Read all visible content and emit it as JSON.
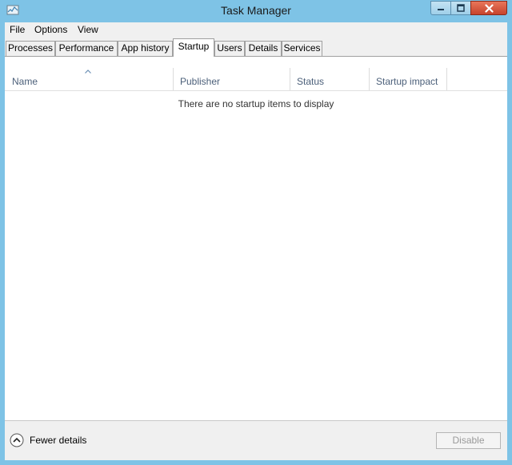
{
  "window": {
    "title": "Task Manager",
    "accent_color": "#7ec3e6",
    "close_color": "#c7432c",
    "icon": "task-manager-icon"
  },
  "menu": {
    "items": [
      "File",
      "Options",
      "View"
    ]
  },
  "tabs": {
    "items": [
      "Processes",
      "Performance",
      "App history",
      "Startup",
      "Users",
      "Details",
      "Services"
    ],
    "active": "Startup"
  },
  "columns": [
    "Name",
    "Publisher",
    "Status",
    "Startup impact"
  ],
  "sorted_column": "Name",
  "empty_message": "There are no startup items to display",
  "footer": {
    "fewer_details_label": "Fewer details",
    "disable_label": "Disable",
    "disable_enabled": false
  }
}
